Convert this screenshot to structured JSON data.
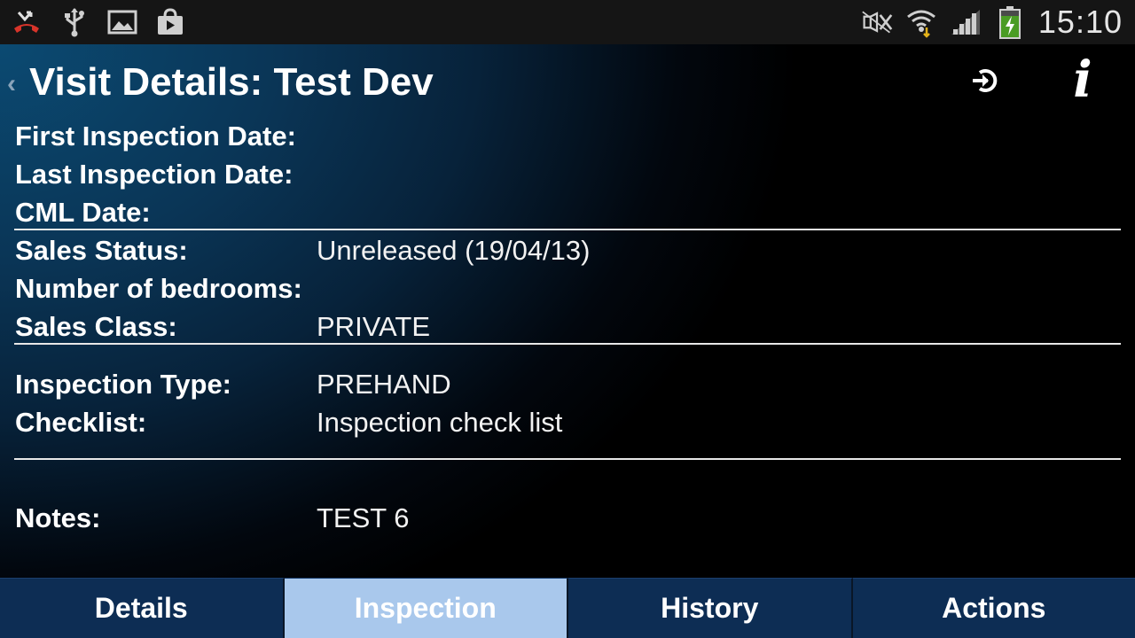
{
  "status_bar": {
    "time": "15:10",
    "left_icons": [
      "missed-call-icon",
      "usb-icon",
      "image-icon",
      "shopping-bag-icon"
    ],
    "right_icons": [
      "mute-icon",
      "wifi-icon",
      "signal-icon",
      "battery-charging-icon"
    ]
  },
  "header": {
    "back_glyph": "‹",
    "title": "Visit Details: Test Dev",
    "info_glyph": "i"
  },
  "fields": {
    "first_inspection_date": {
      "label": "First Inspection Date:",
      "value": ""
    },
    "last_inspection_date": {
      "label": "Last Inspection Date:",
      "value": ""
    },
    "cml_date": {
      "label": "CML Date:",
      "value": ""
    },
    "sales_status": {
      "label": "Sales Status:",
      "value": "Unreleased (19/04/13)"
    },
    "number_of_bedrooms": {
      "label": "Number of bedrooms:",
      "value": ""
    },
    "sales_class": {
      "label": "Sales Class:",
      "value": "PRIVATE"
    },
    "inspection_type": {
      "label": "Inspection Type:",
      "value": "PREHAND"
    },
    "checklist": {
      "label": "Checklist:",
      "value": "Inspection check list"
    },
    "notes": {
      "label": "Notes:",
      "value": "TEST 6"
    }
  },
  "tabs": [
    {
      "label": "Details",
      "active": false
    },
    {
      "label": "Inspection",
      "active": true
    },
    {
      "label": "History",
      "active": false
    },
    {
      "label": "Actions",
      "active": false
    }
  ],
  "colors": {
    "active_tab": "#a9c8ec",
    "tab": "#0d2d54",
    "background_top": "#0b4a72"
  }
}
